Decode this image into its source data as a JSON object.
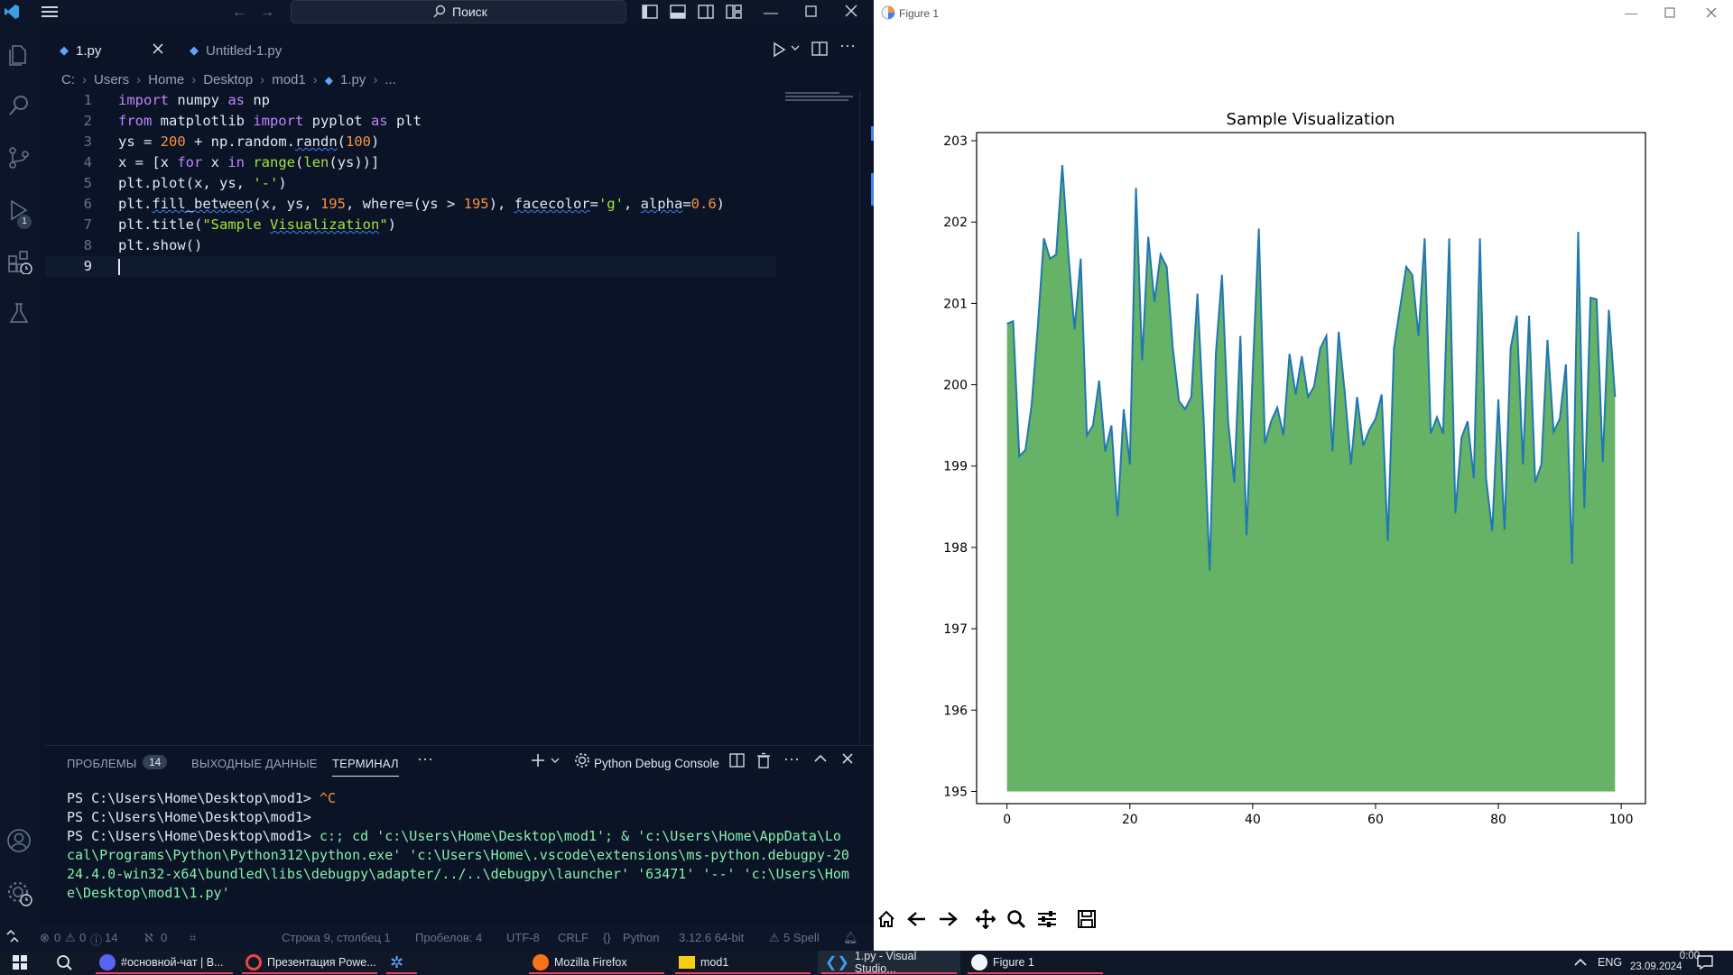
{
  "vscode": {
    "search_label": "Поиск",
    "tabs": [
      {
        "label": "1.py",
        "active": true
      },
      {
        "label": "Untitled-1.py",
        "active": false
      }
    ],
    "breadcrumb": [
      "C:",
      "Users",
      "Home",
      "Desktop",
      "mod1",
      "1.py",
      "..."
    ],
    "code_lines": [
      {
        "n": "1"
      },
      {
        "n": "2"
      },
      {
        "n": "3"
      },
      {
        "n": "4"
      },
      {
        "n": "5"
      },
      {
        "n": "6"
      },
      {
        "n": "7"
      },
      {
        "n": "8"
      },
      {
        "n": "9"
      }
    ],
    "activity_badge": "1",
    "panel": {
      "tabs": {
        "problems": "ПРОБЛЕМЫ",
        "problems_count": "14",
        "output": "ВЫХОДНЫЕ ДАННЫЕ",
        "terminal": "ТЕРМИНАЛ"
      },
      "console_name": "Python Debug Console",
      "terminal_lines": [
        {
          "prompt": "PS C:\\Users\\Home\\Desktop\\mod1>",
          "rest": " ^C"
        },
        {
          "prompt": "PS C:\\Users\\Home\\Desktop\\mod1>",
          "rest": ""
        },
        {
          "prompt": "PS C:\\Users\\Home\\Desktop\\mod1>",
          "rest": "  c:; cd 'c:\\Users\\Home\\Desktop\\mod1'; & 'c:\\Users\\Home\\AppData\\Lo"
        },
        {
          "prompt": "",
          "rest": "cal\\Programs\\Python\\Python312\\python.exe' 'c:\\Users\\Home\\.vscode\\extensions\\ms-python.debugpy-20"
        },
        {
          "prompt": "",
          "rest": "24.4.0-win32-x64\\bundled\\libs\\debugpy\\adapter/../..\\debugpy\\launcher' '63471' '--' 'c:\\Users\\Hom"
        },
        {
          "prompt": "",
          "rest": "e\\Desktop\\mod1\\1.py'"
        }
      ]
    },
    "status": {
      "errors": "0",
      "warnings": "0",
      "info": "14",
      "ports": "0",
      "position": "Строка 9, столбец 1",
      "spaces": "Пробелов: 4",
      "encoding": "UTF-8",
      "eol": "CRLF",
      "language": "Python",
      "interpreter": "3.12.6 64-bit",
      "spell": "5 Spell"
    }
  },
  "figure": {
    "window_title": "Figure 1"
  },
  "chart_data": {
    "type": "area",
    "title": "Sample Visualization",
    "xlabel": "",
    "ylabel": "",
    "xlim": [
      -4.95,
      103.95
    ],
    "ylim": [
      194.85,
      203.1
    ],
    "x_ticks": [
      "0",
      "20",
      "40",
      "60",
      "80",
      "100"
    ],
    "y_ticks": [
      "195",
      "196",
      "197",
      "198",
      "199",
      "200",
      "201",
      "202",
      "203"
    ],
    "fill_baseline": 195,
    "fill_color": "#66b266",
    "line_color": "#1f77b4",
    "grid": false,
    "series": [
      {
        "values": [
          200.75,
          200.78,
          199.12,
          199.2,
          199.75,
          200.7,
          201.8,
          201.55,
          201.6,
          202.7,
          201.6,
          200.68,
          201.55,
          199.38,
          199.5,
          200.05,
          199.18,
          199.5,
          198.38,
          199.7,
          199.02,
          202.42,
          200.3,
          201.82,
          201.02,
          201.6,
          201.45,
          200.45,
          199.8,
          199.7,
          199.85,
          201.12,
          199.6,
          197.72,
          200.38,
          201.35,
          199.55,
          198.8,
          200.6,
          198.15,
          200.15,
          201.92,
          199.28,
          199.55,
          199.72,
          199.38,
          200.38,
          199.88,
          200.35,
          199.85,
          199.98,
          200.45,
          200.6,
          199.18,
          200.65,
          199.9,
          199.02,
          199.85,
          199.25,
          199.45,
          199.58,
          199.88,
          198.08,
          200.45,
          200.95,
          201.45,
          201.35,
          200.6,
          201.8,
          199.4,
          199.6,
          199.4,
          201.8,
          198.42,
          199.35,
          199.55,
          198.85,
          201.8,
          198.85,
          198.2,
          199.82,
          198.22,
          200.45,
          200.85,
          199.02,
          200.85,
          198.8,
          199.02,
          200.55,
          199.42,
          199.58,
          200.25,
          197.8,
          201.88,
          198.48,
          201.07,
          201.05,
          199.05,
          200.92,
          199.85
        ]
      }
    ]
  },
  "taskbar": {
    "items": [
      {
        "label": "#основной-чат | B..."
      },
      {
        "label": "Презентация Powe..."
      },
      {
        "label": ""
      },
      {
        "label": "Mozilla Firefox"
      },
      {
        "label": "mod1"
      },
      {
        "label": "1.py - Visual Studio..."
      },
      {
        "label": "Figure 1"
      }
    ],
    "lang": "ENG",
    "time": "0:00",
    "date": "23.09.2024"
  }
}
